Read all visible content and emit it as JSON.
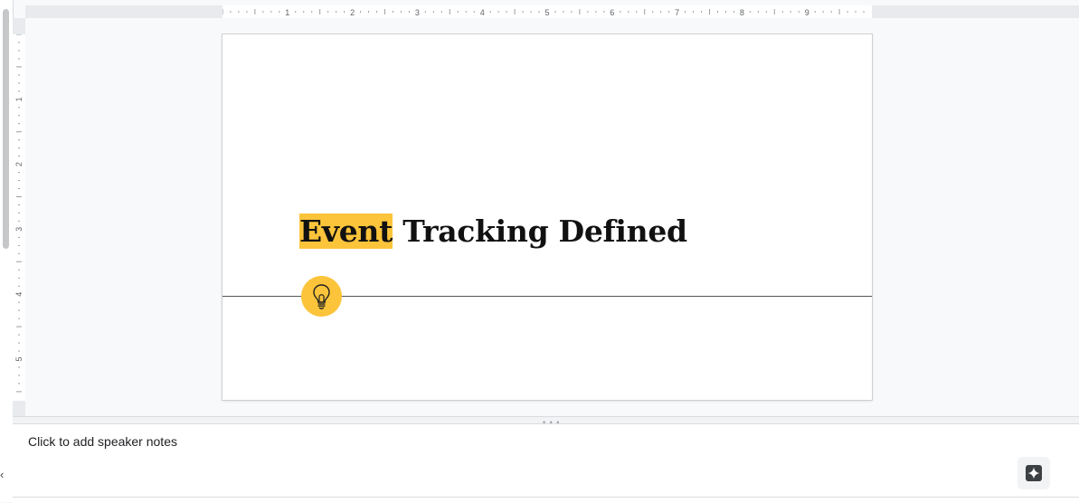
{
  "ruler": {
    "horizontal_labels": [
      "1",
      "2",
      "3",
      "4",
      "5",
      "6",
      "7",
      "8",
      "9"
    ],
    "vertical_labels": [
      "1",
      "2",
      "3",
      "4",
      "5"
    ]
  },
  "slide": {
    "title_highlight": "Event",
    "title_rest": " Tracking Defined",
    "accent_color": "#fcc43a"
  },
  "notes": {
    "placeholder": "Click to add speaker notes"
  },
  "icons": {
    "slide_icon": "lightbulb-icon",
    "ai_button_icon": "sparkle-icon",
    "collapse_icon": "chevron-left-icon"
  }
}
